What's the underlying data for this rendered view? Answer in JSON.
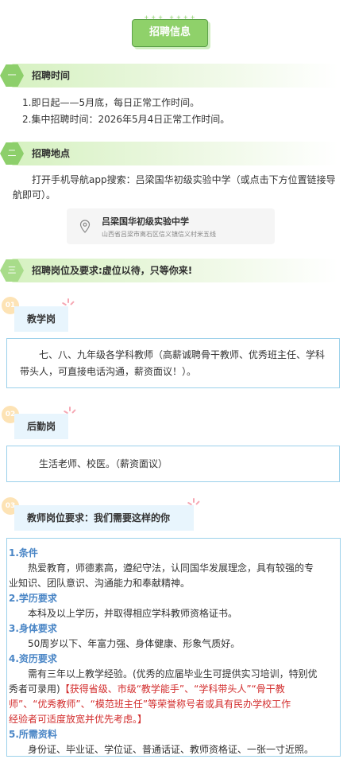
{
  "header": {
    "title": "招聘信息",
    "dots": "+++ ++++"
  },
  "sections": {
    "time": {
      "num": "一",
      "title": "招聘时间",
      "lines": [
        "1.即日起——5月底，每日正常工作时间。",
        "2.集中招聘时间：2026年5月4日正常工作时间。"
      ]
    },
    "place": {
      "num": "二",
      "title": "招聘地点",
      "text": "打开手机导航app搜索：吕梁国华初级实验中学（或点击下方位置链接导航即可）。",
      "location": {
        "name": "吕梁国华初级实验中学",
        "address": "山西省吕梁市离石区信义镇信义村米五线"
      }
    },
    "positions": {
      "num": "三",
      "title": "招聘岗位及要求:虚位以待，只等你来!"
    }
  },
  "jobs": [
    {
      "num": "01",
      "tag": "教学岗",
      "desc": "七、八、九年级各学科教师（高薪诚聘骨干教师、优秀班主任、学科带头人，可直接电话沟通，薪资面议！）。"
    },
    {
      "num": "02",
      "tag": "后勤岗",
      "desc": "生活老师、校医。（薪资面议）"
    },
    {
      "num": "03",
      "tag": "教师岗位要求：我们需要这样的你"
    }
  ],
  "requirements": {
    "cond_h": "1.条件",
    "cond_l1": "热爱教育，师德素高，遵纪守法，认同国华发展理念，具有较强的专",
    "cond_l2": "业知识、团队意识、沟通能力和奉献精神。",
    "edu_h": "2.学历要求",
    "edu_l1": "本科及以上学历，并取得相应学科教师资格证书。",
    "body_h": "3.身体要求",
    "body_l1": "50周岁以下、年富力强、身体健康、形象气质好。",
    "exp_h": "4.资历要求",
    "exp_l1": "需有三年以上教学经验。(优秀的应届毕业生可提供实习培训，特别优",
    "exp_l2a": "秀者可录用)",
    "exp_l2b": "【获得省级、市级“教学能手”、“学科带头人”“骨干教",
    "exp_l3": "师”、“优秀教师”、“模范班主任”等荣誉称号者或具有民办学校工作",
    "exp_l4": "经验者可适度放宽并优先考虑。】",
    "doc_h": "5.所需资料",
    "doc_l1": "身份证、毕业证、学位证、普通话证、教师资格证、一张一寸近照。"
  },
  "colors": {
    "green": "#8dcf6b",
    "blue_border": "#9bd0ea",
    "tag_bg": "#e8f5fd",
    "red": "#d22c2c",
    "heading_blue": "#4a86c6"
  },
  "icons": {
    "location": "location-pin-icon",
    "spark": "sparkle-icon"
  }
}
